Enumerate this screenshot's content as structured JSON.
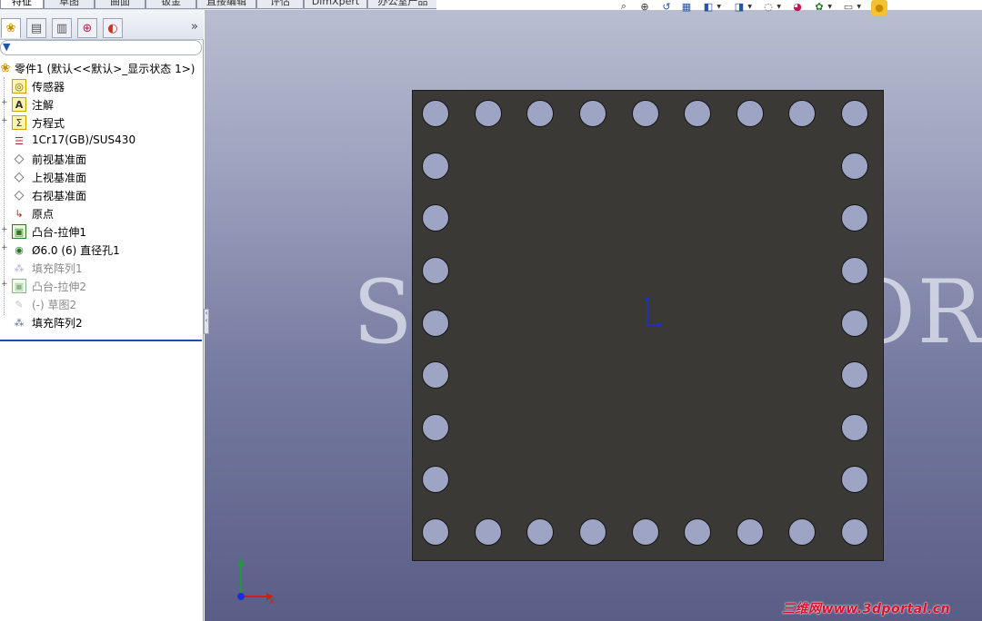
{
  "command_tabs": [
    {
      "label": "特征",
      "active": true
    },
    {
      "label": "草图",
      "active": false
    },
    {
      "label": "曲面",
      "active": false
    },
    {
      "label": "钣金",
      "active": false
    },
    {
      "label": "直接编辑",
      "active": false
    },
    {
      "label": "评估",
      "active": false
    },
    {
      "label": "DimXpert",
      "active": false
    },
    {
      "label": "办公室产品",
      "active": false
    }
  ],
  "panel_tabs": [
    {
      "icon": "feature-manager-icon",
      "glyph": "❀"
    },
    {
      "icon": "property-manager-icon",
      "glyph": "▤"
    },
    {
      "icon": "configuration-manager-icon",
      "glyph": "▥"
    },
    {
      "icon": "dimxpert-manager-icon",
      "glyph": "⊕"
    },
    {
      "icon": "display-manager-icon",
      "glyph": "◐"
    }
  ],
  "panel_more": "»",
  "tree": {
    "root": "零件1  (默认<<默认>_显示状态 1>)",
    "items": [
      {
        "label": "传感器",
        "icon": "sensor-icon",
        "glyph": "◎",
        "expandable": false,
        "dim": false
      },
      {
        "label": "注解",
        "icon": "annotation-icon",
        "glyph": "A",
        "expandable": true,
        "dim": false
      },
      {
        "label": "方程式",
        "icon": "equation-icon",
        "glyph": "Σ",
        "expandable": true,
        "dim": false
      },
      {
        "label": "1Cr17(GB)/SUS430",
        "icon": "material-icon",
        "glyph": "☰",
        "expandable": false,
        "dim": false
      },
      {
        "label": "前视基准面",
        "icon": "plane-icon",
        "glyph": "◇",
        "expandable": false,
        "dim": false
      },
      {
        "label": "上视基准面",
        "icon": "plane-icon",
        "glyph": "◇",
        "expandable": false,
        "dim": false
      },
      {
        "label": "右视基准面",
        "icon": "plane-icon",
        "glyph": "◇",
        "expandable": false,
        "dim": false
      },
      {
        "label": "原点",
        "icon": "origin-icon",
        "glyph": "↳",
        "expandable": false,
        "dim": false
      },
      {
        "label": "凸台-拉伸1",
        "icon": "extrude-icon",
        "glyph": "▣",
        "expandable": true,
        "dim": false
      },
      {
        "label": "Ø6.0 (6) 直径孔1",
        "icon": "hole-wizard-icon",
        "glyph": "◉",
        "expandable": true,
        "dim": false
      },
      {
        "label": "填充阵列1",
        "icon": "fill-pattern-icon",
        "glyph": "⁂",
        "expandable": false,
        "dim": true
      },
      {
        "label": "凸台-拉伸2",
        "icon": "extrude-icon",
        "glyph": "▣",
        "expandable": true,
        "dim": true
      },
      {
        "label": "(-) 草图2",
        "icon": "sketch-icon",
        "glyph": "✎",
        "expandable": false,
        "dim": true
      },
      {
        "label": "填充阵列2",
        "icon": "fill-pattern-icon",
        "glyph": "⁂",
        "expandable": false,
        "dim": false
      }
    ]
  },
  "heads_up_toolbar": [
    {
      "icon": "zoom-to-fit-icon",
      "glyph": "⌕"
    },
    {
      "icon": "zoom-to-area-icon",
      "glyph": "⊕"
    },
    {
      "icon": "previous-view-icon",
      "glyph": "↺"
    },
    {
      "icon": "section-view-icon",
      "glyph": "▦"
    },
    {
      "icon": "view-orientation-icon",
      "glyph": "◧"
    },
    {
      "icon": "display-style-icon",
      "glyph": "◨"
    },
    {
      "icon": "hide-show-items-icon",
      "glyph": "◌"
    },
    {
      "icon": "edit-appearance-icon",
      "glyph": "◕"
    },
    {
      "icon": "apply-scene-icon",
      "glyph": "✿"
    },
    {
      "icon": "view-settings-icon",
      "glyph": "▭"
    },
    {
      "icon": "realview-icon",
      "glyph": "●"
    }
  ],
  "watermark_left": "S",
  "watermark_right": "OR",
  "credit": "三维网www.3dportal.cn",
  "colors": {
    "plate": "#3a3936",
    "hole": "#9da4c4",
    "tree_selected_bar": "#1f4fa0",
    "credit": "#d8102a"
  }
}
